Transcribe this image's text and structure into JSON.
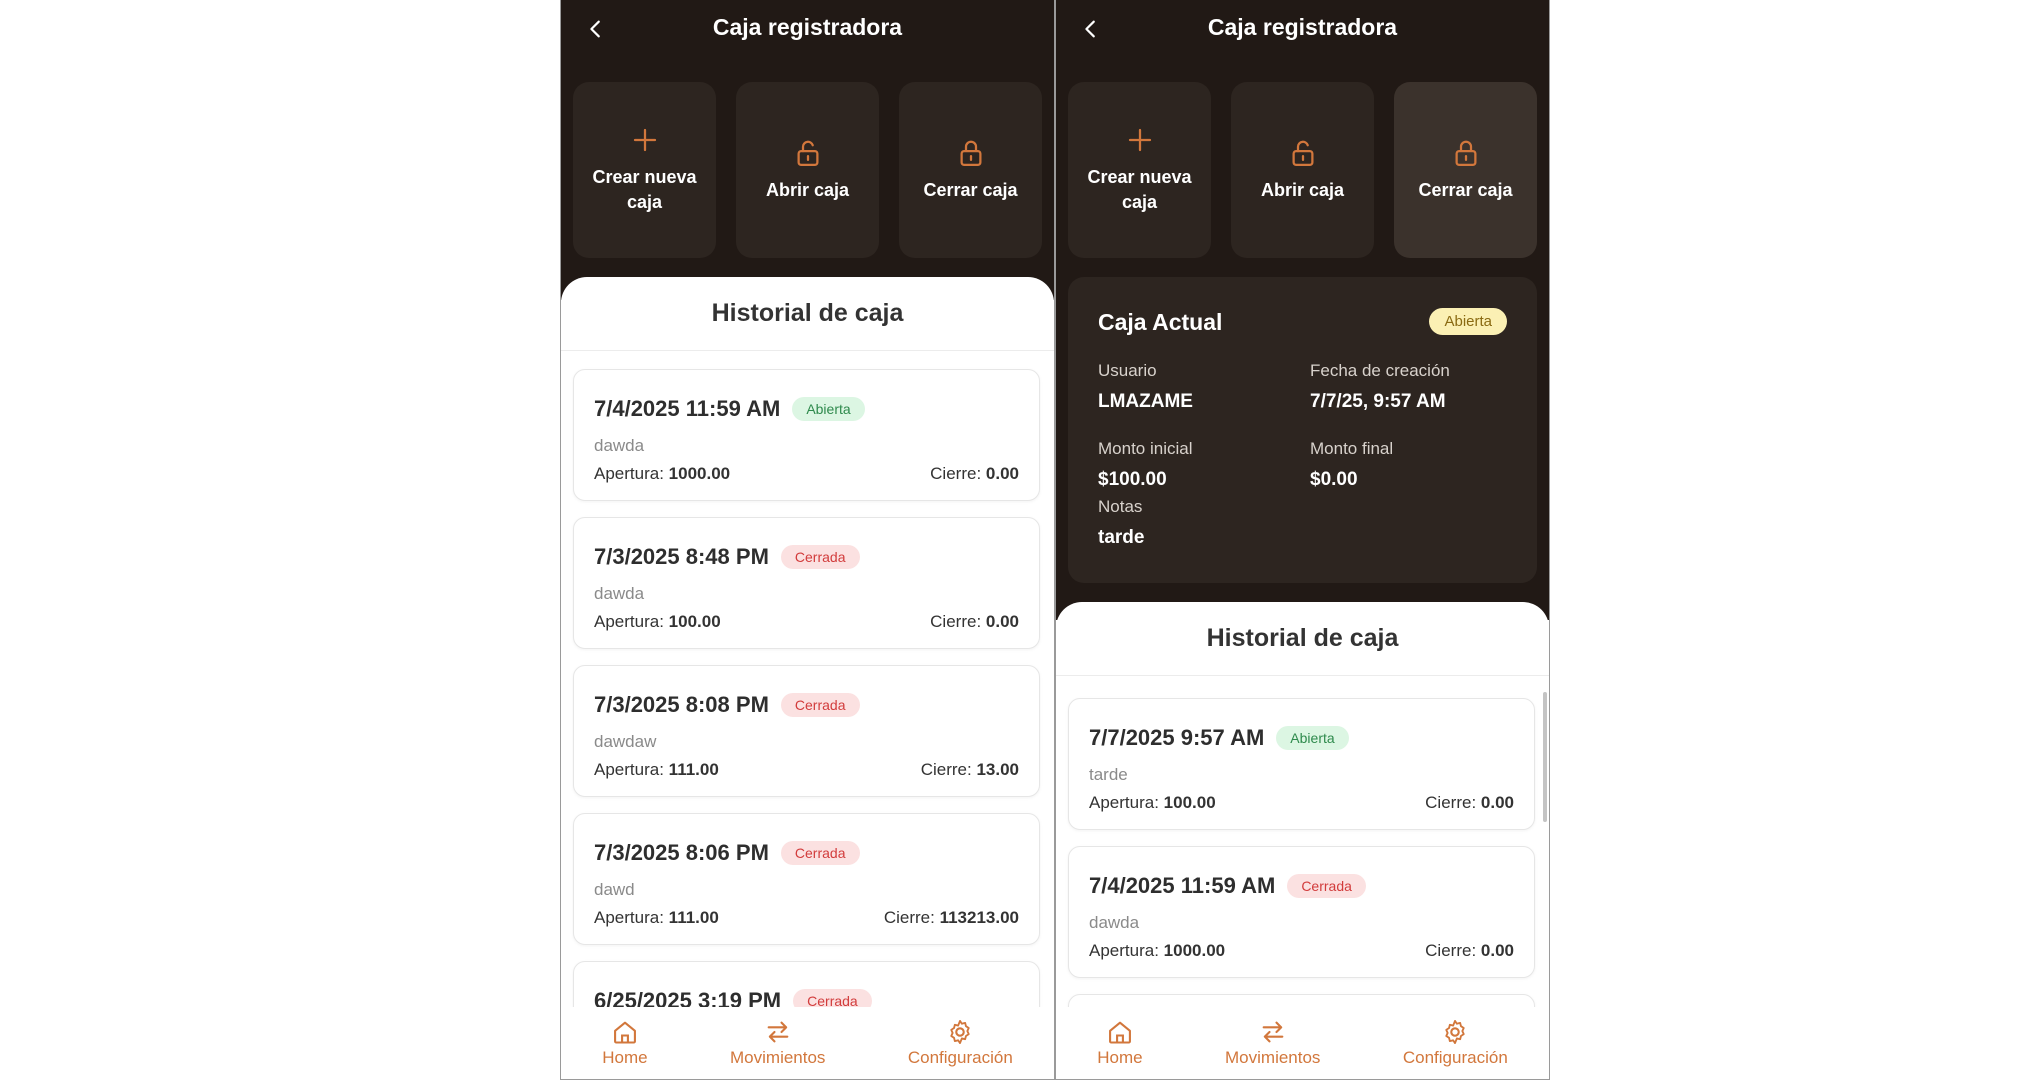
{
  "accent_color": "#d2773c",
  "dark_bg": "#211915",
  "left_screen": {
    "title": "Caja registradora",
    "actions": [
      {
        "label": "Crear nueva caja",
        "icon": "plus-icon"
      },
      {
        "label": "Abrir caja",
        "icon": "unlock-icon"
      },
      {
        "label": "Cerrar caja",
        "icon": "lock-icon"
      }
    ],
    "history_title": "Historial de caja",
    "history": [
      {
        "date": "7/4/2025 11:59 AM",
        "status": "Abierta",
        "note": "dawda",
        "apertura_label": "Apertura:",
        "apertura": "1000.00",
        "cierre_label": "Cierre:",
        "cierre": "0.00"
      },
      {
        "date": "7/3/2025 8:48 PM",
        "status": "Cerrada",
        "note": "dawda",
        "apertura_label": "Apertura:",
        "apertura": "100.00",
        "cierre_label": "Cierre:",
        "cierre": "0.00"
      },
      {
        "date": "7/3/2025 8:08 PM",
        "status": "Cerrada",
        "note": "dawdaw",
        "apertura_label": "Apertura:",
        "apertura": "111.00",
        "cierre_label": "Cierre:",
        "cierre": "13.00"
      },
      {
        "date": "7/3/2025 8:06 PM",
        "status": "Cerrada",
        "note": "dawd",
        "apertura_label": "Apertura:",
        "apertura": "111.00",
        "cierre_label": "Cierre:",
        "cierre": "113213.00"
      },
      {
        "date": "6/25/2025 3:19 PM",
        "status": "Cerrada",
        "note": "",
        "apertura_label": "",
        "apertura": "",
        "cierre_label": "",
        "cierre": ""
      }
    ],
    "nav": [
      {
        "label": "Home",
        "icon": "home-icon"
      },
      {
        "label": "Movimientos",
        "icon": "transfer-icon"
      },
      {
        "label": "Configuración",
        "icon": "gear-icon"
      }
    ]
  },
  "right_screen": {
    "title": "Caja registradora",
    "actions": [
      {
        "label": "Crear nueva caja",
        "icon": "plus-icon"
      },
      {
        "label": "Abrir caja",
        "icon": "unlock-icon"
      },
      {
        "label": "Cerrar caja",
        "icon": "lock-icon"
      }
    ],
    "current": {
      "title": "Caja Actual",
      "status": "Abierta",
      "usuario_label": "Usuario",
      "usuario": "LMAZAME",
      "fecha_label": "Fecha de creación",
      "fecha": "7/7/25, 9:57 AM",
      "monto_inicial_label": "Monto inicial",
      "monto_inicial": "$100.00",
      "monto_final_label": "Monto final",
      "monto_final": "$0.00",
      "notas_label": "Notas",
      "notas": "tarde"
    },
    "history_title": "Historial de caja",
    "history": [
      {
        "date": "7/7/2025 9:57 AM",
        "status": "Abierta",
        "note": "tarde",
        "apertura_label": "Apertura:",
        "apertura": "100.00",
        "cierre_label": "Cierre:",
        "cierre": "0.00"
      },
      {
        "date": "7/4/2025 11:59 AM",
        "status": "Cerrada",
        "note": "dawda",
        "apertura_label": "Apertura:",
        "apertura": "1000.00",
        "cierre_label": "Cierre:",
        "cierre": "0.00"
      }
    ],
    "nav": [
      {
        "label": "Home",
        "icon": "home-icon"
      },
      {
        "label": "Movimientos",
        "icon": "transfer-icon"
      },
      {
        "label": "Configuración",
        "icon": "gear-icon"
      }
    ]
  }
}
